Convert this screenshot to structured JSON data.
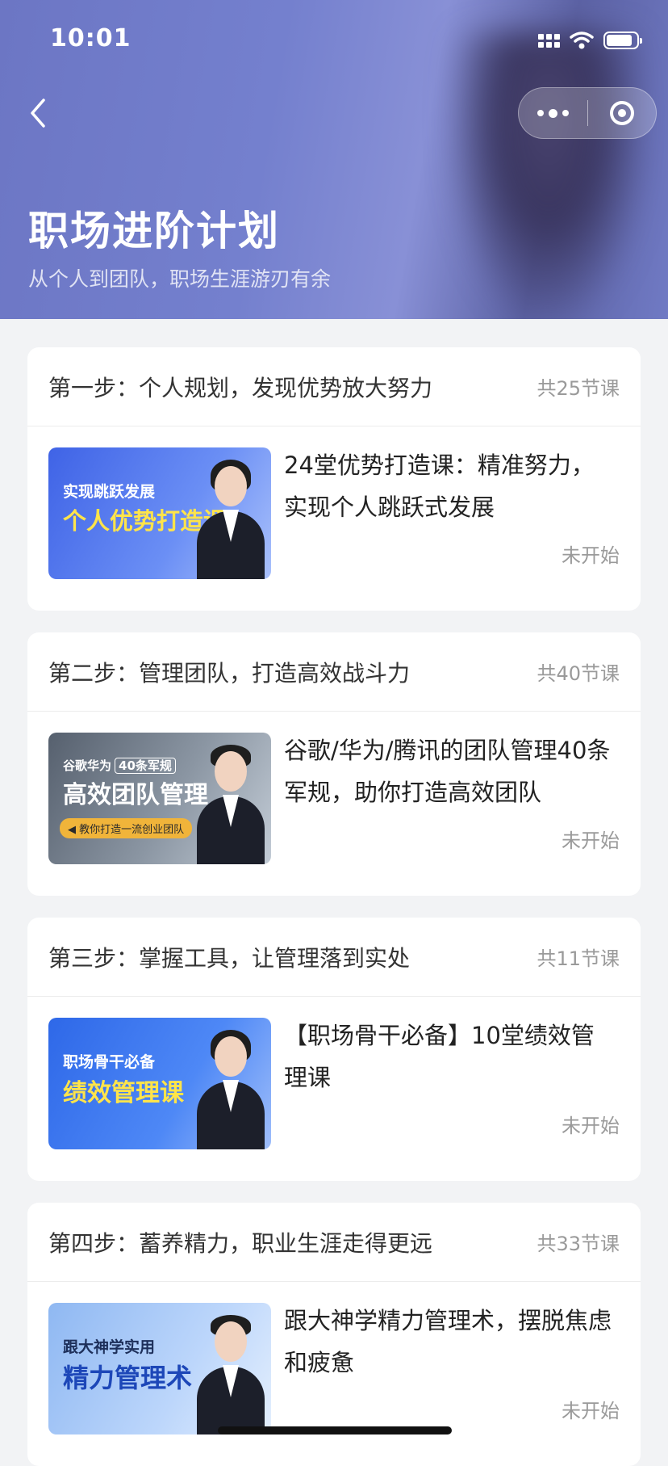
{
  "status_bar": {
    "time": "10:01"
  },
  "header": {
    "title": "职场进阶计划",
    "subtitle": "从个人到团队，职场生涯游刃有余"
  },
  "steps": [
    {
      "title": "第一步：个人规划，发现优势放大努力",
      "count": "共25节课",
      "course": {
        "title": "24堂优势打造课：精准努力，实现个人跳跃式发展",
        "status": "未开始",
        "thumb_line1": "实现跳跃发展",
        "thumb_line2": "个人优势打造课"
      }
    },
    {
      "title": "第二步：管理团队，打造高效战斗力",
      "count": "共40节课",
      "course": {
        "title": "谷歌/华为/腾讯的团队管理40条军规，助你打造高效团队",
        "status": "未开始",
        "thumb_line1": "谷歌华为",
        "thumb_tag": "40条军规",
        "thumb_line2": "高效团队管理",
        "thumb_pill": "◀ 教你打造一流创业团队"
      }
    },
    {
      "title": "第三步：掌握工具，让管理落到实处",
      "count": "共11节课",
      "course": {
        "title": "【职场骨干必备】10堂绩效管理课",
        "status": "未开始",
        "thumb_line1": "职场骨干必备",
        "thumb_line2": "绩效管理课"
      }
    },
    {
      "title": "第四步：蓄养精力，职业生涯走得更远",
      "count": "共33节课",
      "course": {
        "title": "跟大神学精力管理术，摆脱焦虑和疲惫",
        "status": "未开始",
        "thumb_line1": "跟大神学实用",
        "thumb_line2": "精力管理术"
      }
    }
  ]
}
